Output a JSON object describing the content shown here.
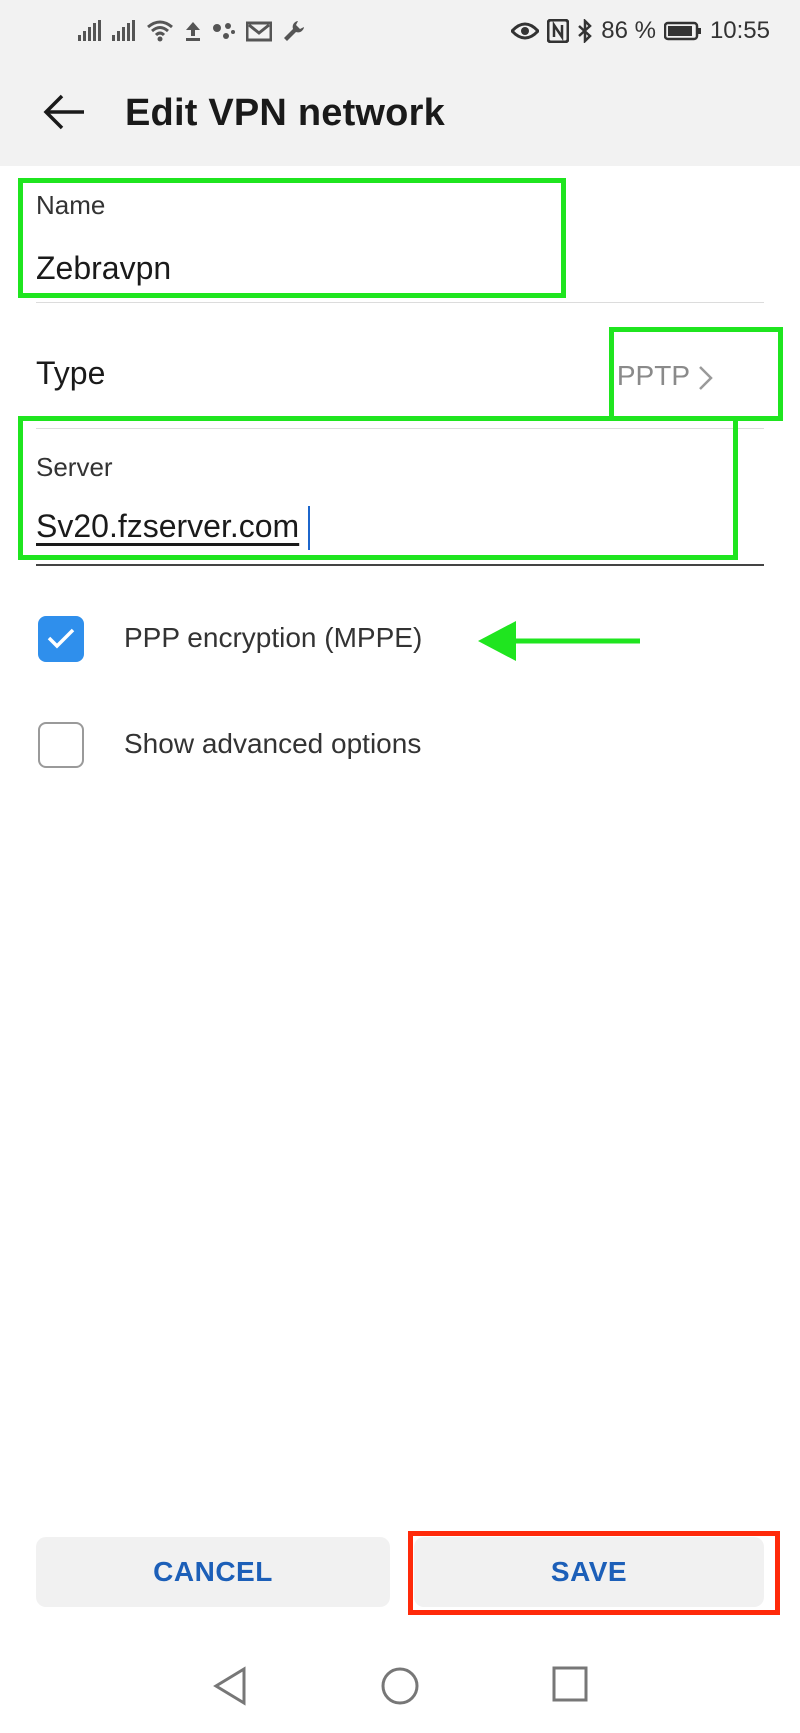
{
  "status_bar": {
    "battery": "86 %",
    "time": "10:55"
  },
  "app_bar": {
    "title": "Edit VPN network"
  },
  "form": {
    "name_label": "Name",
    "name_value": "Zebravpn",
    "type_label": "Type",
    "type_value": "PPTP",
    "server_label": "Server",
    "server_value": "Sv20.fzserver.com"
  },
  "options": [
    {
      "label": "PPP encryption (MPPE)",
      "checked": true
    },
    {
      "label": "Show advanced options",
      "checked": false
    }
  ],
  "buttons": {
    "cancel_label": "CANCEL",
    "save_label": "SAVE"
  },
  "colors": {
    "accent": "#2f8fec",
    "button_text": "#1c5fb8",
    "highlight_green": "#1fe51f",
    "highlight_red": "#ff2a0a"
  },
  "icons": {
    "back": "arrow-left-icon",
    "chevron": "chevron-right-icon",
    "nav_back": "triangle-back-icon",
    "nav_home": "circle-home-icon",
    "nav_recents": "square-recents-icon"
  }
}
